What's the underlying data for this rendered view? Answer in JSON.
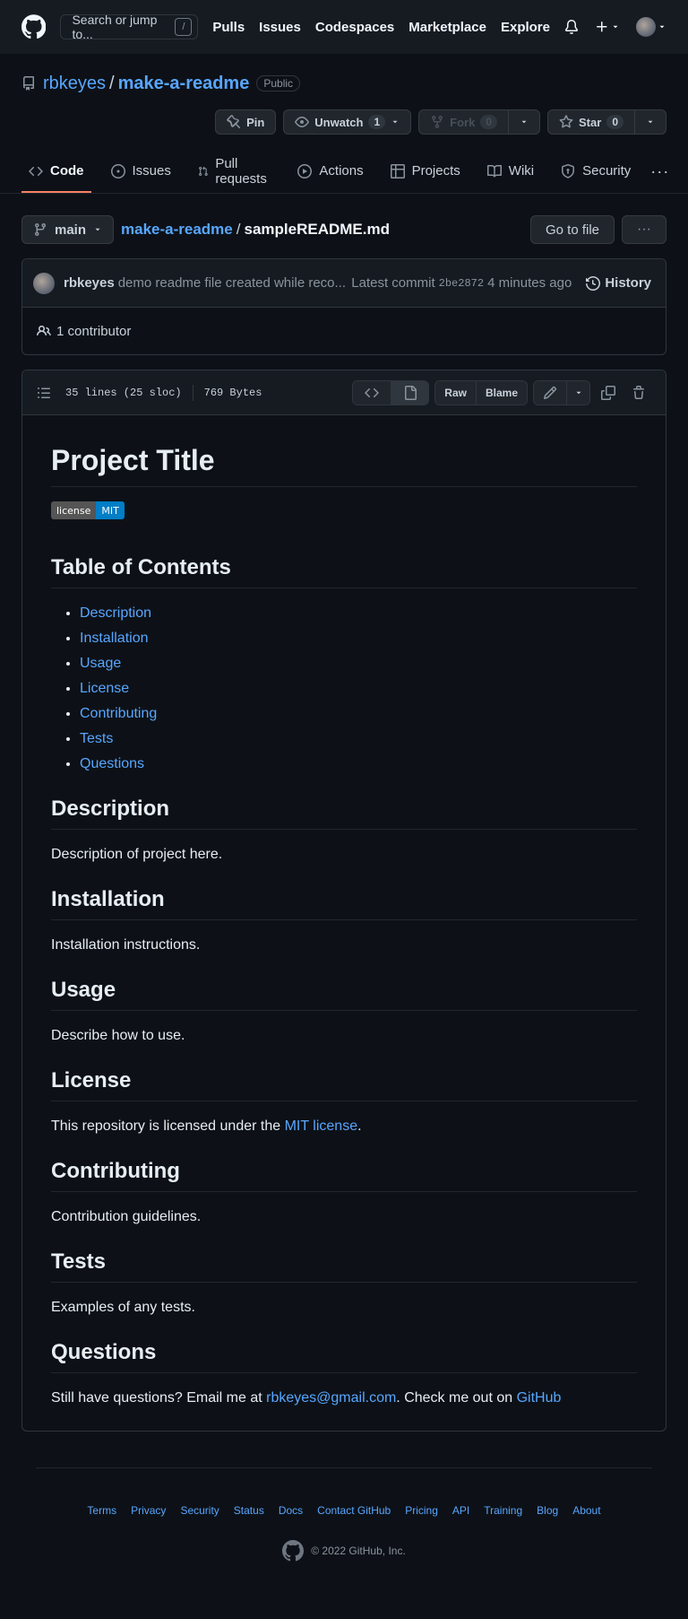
{
  "header": {
    "search_placeholder": "Search or jump to...",
    "search_key": "/",
    "nav": [
      "Pulls",
      "Issues",
      "Codespaces",
      "Marketplace",
      "Explore"
    ]
  },
  "repo": {
    "owner": "rbkeyes",
    "name": "make-a-readme",
    "visibility": "Public",
    "pin_label": "Pin",
    "unwatch_label": "Unwatch",
    "watch_count": "1",
    "fork_label": "Fork",
    "fork_count": "0",
    "star_label": "Star",
    "star_count": "0"
  },
  "tabs": [
    {
      "label": "Code",
      "icon": "code-icon"
    },
    {
      "label": "Issues",
      "icon": "issue-icon"
    },
    {
      "label": "Pull requests",
      "icon": "pull-request-icon"
    },
    {
      "label": "Actions",
      "icon": "play-icon"
    },
    {
      "label": "Projects",
      "icon": "table-icon"
    },
    {
      "label": "Wiki",
      "icon": "book-icon"
    },
    {
      "label": "Security",
      "icon": "shield-icon"
    }
  ],
  "filenav": {
    "branch": "main",
    "repo_crumb": "make-a-readme",
    "file_crumb": "sampleREADME.md",
    "goto_label": "Go to file"
  },
  "commit": {
    "author": "rbkeyes",
    "message": "demo readme file created while reco...",
    "latest_label": "Latest commit",
    "sha": "2be2872",
    "time": "4 minutes ago",
    "history_label": "History",
    "contributors": "1 contributor"
  },
  "file": {
    "lines": "35 lines (25 sloc)",
    "size": "769 Bytes",
    "raw_label": "Raw",
    "blame_label": "Blame"
  },
  "readme": {
    "title": "Project Title",
    "badge_left": "license",
    "badge_right": "MIT",
    "toc_heading": "Table of Contents",
    "toc": [
      "Description",
      "Installation",
      "Usage",
      "License",
      "Contributing",
      "Tests",
      "Questions"
    ],
    "description_heading": "Description",
    "description_text": "Description of project here.",
    "installation_heading": "Installation",
    "installation_text": "Installation instructions.",
    "usage_heading": "Usage",
    "usage_text": "Describe how to use.",
    "license_heading": "License",
    "license_text_before": "This repository is licensed under the ",
    "license_link": "MIT license",
    "license_text_after": ".",
    "contributing_heading": "Contributing",
    "contributing_text": "Contribution guidelines.",
    "tests_heading": "Tests",
    "tests_text": "Examples of any tests.",
    "questions_heading": "Questions",
    "questions_text_before": "Still have questions? Email me at ",
    "questions_email": "rbkeyes@gmail.com",
    "questions_text_mid": ". Check me out on ",
    "questions_github": "GitHub"
  },
  "footer": {
    "links": [
      "Terms",
      "Privacy",
      "Security",
      "Status",
      "Docs",
      "Contact GitHub",
      "Pricing",
      "API",
      "Training",
      "Blog",
      "About"
    ],
    "copyright": "© 2022 GitHub, Inc."
  },
  "colors": {
    "background": "#0d1117",
    "header": "#161b22",
    "link": "#58a6ff",
    "active_tab_underline": "#f78166"
  }
}
